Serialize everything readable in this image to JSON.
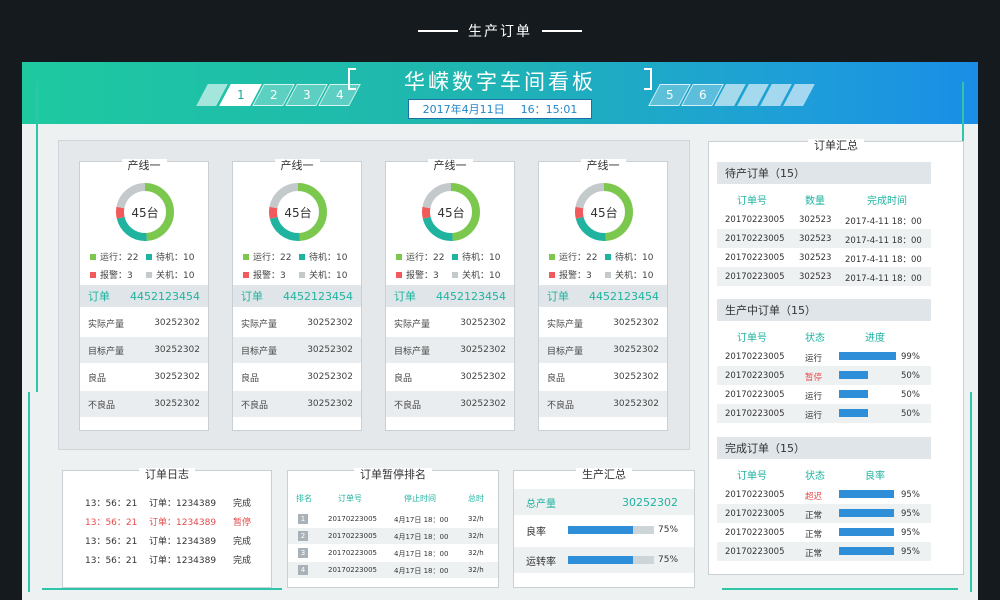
{
  "page_caption": "生产订单",
  "header": {
    "title": "华嵘数字车间看板",
    "date": "2017年4月11日",
    "time": "16：15:01",
    "tabs_left": [
      "1",
      "2",
      "3",
      "4"
    ],
    "tabs_right": [
      "5",
      "6"
    ]
  },
  "lines": [
    {
      "title": "产线一",
      "center": "45台",
      "running": "运行：22",
      "standby": "待机：10",
      "alarm": "报警：3",
      "off": "关机：10",
      "order_label": "订单",
      "order_no": "4452123454",
      "rows": [
        {
          "label": "实际产量",
          "value": "30252302"
        },
        {
          "label": "目标产量",
          "value": "30252302"
        },
        {
          "label": "良品",
          "value": "30252302"
        },
        {
          "label": "不良品",
          "value": "30252302"
        }
      ]
    },
    {
      "title": "产线一",
      "center": "45台",
      "running": "运行：22",
      "standby": "待机：10",
      "alarm": "报警：3",
      "off": "关机：10",
      "order_label": "订单",
      "order_no": "4452123454",
      "rows": [
        {
          "label": "实际产量",
          "value": "30252302"
        },
        {
          "label": "目标产量",
          "value": "30252302"
        },
        {
          "label": "良品",
          "value": "30252302"
        },
        {
          "label": "不良品",
          "value": "30252302"
        }
      ]
    },
    {
      "title": "产线一",
      "center": "45台",
      "running": "运行：22",
      "standby": "待机：10",
      "alarm": "报警：3",
      "off": "关机：10",
      "order_label": "订单",
      "order_no": "4452123454",
      "rows": [
        {
          "label": "实际产量",
          "value": "30252302"
        },
        {
          "label": "目标产量",
          "value": "30252302"
        },
        {
          "label": "良品",
          "value": "30252302"
        },
        {
          "label": "不良品",
          "value": "30252302"
        }
      ]
    },
    {
      "title": "产线一",
      "center": "45台",
      "running": "运行：22",
      "standby": "待机：10",
      "alarm": "报警：3",
      "off": "关机：10",
      "order_label": "订单",
      "order_no": "4452123454",
      "rows": [
        {
          "label": "实际产量",
          "value": "30252302"
        },
        {
          "label": "目标产量",
          "value": "30252302"
        },
        {
          "label": "良品",
          "value": "30252302"
        },
        {
          "label": "不良品",
          "value": "30252302"
        }
      ]
    }
  ],
  "status_colors": {
    "running": "#7cc84f",
    "standby": "#1fb3a0",
    "alarm": "#f2595a",
    "off": "#c4c9cc"
  },
  "order_log": {
    "title": "订单日志",
    "rows": [
      {
        "time": "13：56：21",
        "order": "订单：1234389",
        "status": "完成",
        "warn": false
      },
      {
        "time": "13：56：21",
        "order": "订单：1234389",
        "status": "暂停",
        "warn": true
      },
      {
        "time": "13：56：21",
        "order": "订单：1234389",
        "status": "完成",
        "warn": false
      },
      {
        "time": "13：56：21",
        "order": "订单：1234389",
        "status": "完成",
        "warn": false
      }
    ]
  },
  "pause_rank": {
    "title": "订单暂停排名",
    "headers": [
      "排名",
      "订单号",
      "停止时间",
      "总时"
    ],
    "rows": [
      {
        "rank": "1",
        "order": "201702230​05",
        "time": "4月17日 18：00",
        "total": "32/h"
      },
      {
        "rank": "2",
        "order": "201702230​05",
        "time": "4月17日 18：00",
        "total": "32/h"
      },
      {
        "rank": "3",
        "order": "201702230​05",
        "time": "4月17日 18：00",
        "total": "32/h"
      },
      {
        "rank": "4",
        "order": "201702230​05",
        "time": "4月17日 18：00",
        "total": "32/h"
      }
    ]
  },
  "prod_summary": {
    "title": "生产汇总",
    "total_label": "总产量",
    "total_value": "30252302",
    "bars": [
      {
        "label": "良率",
        "value": "75%",
        "fraction": 0.75
      },
      {
        "label": "运转率",
        "value": "75%",
        "fraction": 0.75
      }
    ]
  },
  "order_summary": {
    "title": "订单汇总",
    "pending": {
      "header": "待产订单（15）",
      "columns": [
        "订单号",
        "数量",
        "完成时间"
      ],
      "rows": [
        {
          "order": "20170223005",
          "qty": "302523",
          "time": "2017-4-11 18：00"
        },
        {
          "order": "20170223005",
          "qty": "302523",
          "time": "2017-4-11 18：00"
        },
        {
          "order": "20170223005",
          "qty": "302523",
          "time": "2017-4-11 18：00"
        },
        {
          "order": "20170223005",
          "qty": "302523",
          "time": "2017-4-11 18：00"
        }
      ]
    },
    "in_production": {
      "header": "生产中订单（15）",
      "columns": [
        "订单号",
        "状态",
        "进度"
      ],
      "rows": [
        {
          "order": "20170223005",
          "status": "运行",
          "progress": "99%",
          "fraction": 0.99,
          "red": false
        },
        {
          "order": "20170223005",
          "status": "暂停",
          "progress": "50%",
          "fraction": 0.5,
          "red": true
        },
        {
          "order": "20170223005",
          "status": "运行",
          "progress": "50%",
          "fraction": 0.5,
          "red": false
        },
        {
          "order": "20170223005",
          "status": "运行",
          "progress": "50%",
          "fraction": 0.5,
          "red": false
        }
      ]
    },
    "completed": {
      "header": "完成订单（15）",
      "columns": [
        "订单号",
        "状态",
        "良率"
      ],
      "rows": [
        {
          "order": "20170223005",
          "status": "超迟",
          "rate": "95%",
          "fraction": 0.95,
          "red": true
        },
        {
          "order": "20170223005",
          "status": "正常",
          "rate": "95%",
          "fraction": 0.95,
          "red": false
        },
        {
          "order": "20170223005",
          "status": "正常",
          "rate": "95%",
          "fraction": 0.95,
          "red": false
        },
        {
          "order": "20170223005",
          "status": "正常",
          "rate": "95%",
          "fraction": 0.95,
          "red": false
        }
      ]
    }
  }
}
